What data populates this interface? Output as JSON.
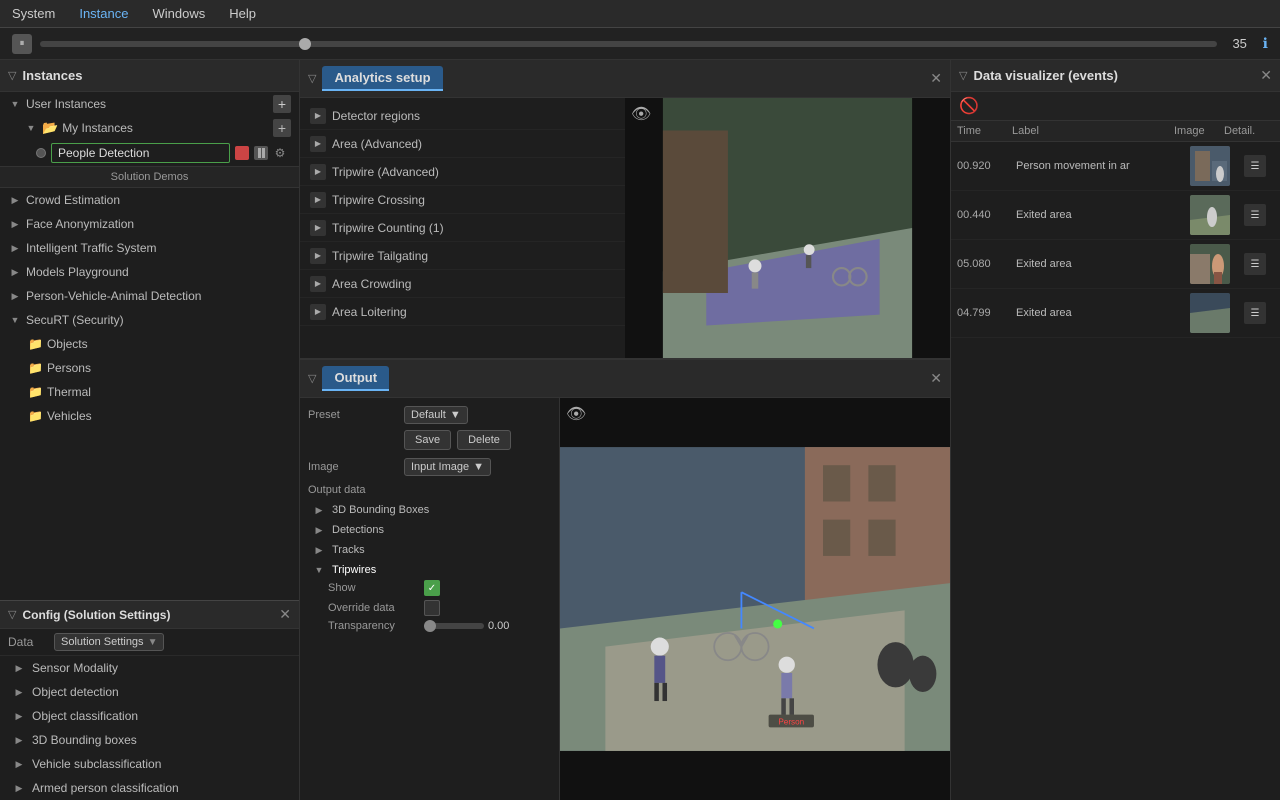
{
  "menubar": {
    "items": [
      {
        "label": "System",
        "active": false
      },
      {
        "label": "Instance",
        "active": true
      },
      {
        "label": "Windows",
        "active": false
      },
      {
        "label": "Help",
        "active": false
      }
    ]
  },
  "timeline": {
    "pause_label": "⏸",
    "value": "35",
    "info_label": "ℹ"
  },
  "instances_panel": {
    "title": "Instances",
    "user_instances_label": "User Instances",
    "my_instances_label": "My Instances",
    "active_instance_name": "People Detection",
    "solution_demos_label": "Solution Demos",
    "demos": [
      {
        "label": "Crowd Estimation"
      },
      {
        "label": "Face Anonymization"
      },
      {
        "label": "Intelligent Traffic System"
      },
      {
        "label": "Models Playground"
      },
      {
        "label": "Person-Vehicle-Animal Detection"
      }
    ],
    "security_label": "SecuRT (Security)",
    "security_items": [
      {
        "label": "Objects"
      },
      {
        "label": "Persons"
      },
      {
        "label": "Thermal"
      },
      {
        "label": "Vehicles"
      }
    ]
  },
  "config_panel": {
    "title": "Config (Solution Settings)",
    "data_label": "Data",
    "data_dropdown": "Solution Settings",
    "items": [
      {
        "label": "Sensor Modality"
      },
      {
        "label": "Object detection"
      },
      {
        "label": "Object classification"
      },
      {
        "label": "3D Bounding boxes"
      },
      {
        "label": "Vehicle subclassification"
      },
      {
        "label": "Armed person classification"
      }
    ]
  },
  "analytics_panel": {
    "title": "Analytics setup",
    "items": [
      {
        "label": "Detector regions"
      },
      {
        "label": "Area (Advanced)"
      },
      {
        "label": "Tripwire (Advanced)"
      },
      {
        "label": "Tripwire Crossing"
      },
      {
        "label": "Tripwire Counting (1)"
      },
      {
        "label": "Tripwire Tailgating"
      },
      {
        "label": "Area Crowding"
      },
      {
        "label": "Area Loitering"
      }
    ]
  },
  "output_panel": {
    "title": "Output",
    "preset_label": "Preset",
    "preset_value": "Default",
    "save_label": "Save",
    "delete_label": "Delete",
    "image_label": "Image",
    "image_value": "Input Image",
    "output_data_label": "Output data",
    "data_items": [
      {
        "label": "3D Bounding Boxes",
        "expanded": false
      },
      {
        "label": "Detections",
        "expanded": false
      },
      {
        "label": "Tracks",
        "expanded": false
      },
      {
        "label": "Tripwires",
        "expanded": true
      }
    ],
    "show_label": "Show",
    "override_label": "Override data",
    "transparency_label": "Transparency",
    "transparency_value": "0.00"
  },
  "data_visualizer": {
    "title": "Data visualizer (events)",
    "columns": {
      "time": "Time",
      "label": "Label",
      "image": "Image",
      "detail": "Detail."
    },
    "events": [
      {
        "time": "00.920",
        "label": "Person movement in ar",
        "has_image": true
      },
      {
        "time": "00.440",
        "label": "Exited area",
        "has_image": true
      },
      {
        "time": "05.080",
        "label": "Exited area",
        "has_image": true
      },
      {
        "time": "04.799",
        "label": "Exited area",
        "has_image": true
      }
    ]
  },
  "icons": {
    "funnel": "▽",
    "play": "▶",
    "pause": "⏸",
    "close": "✕",
    "plus": "+",
    "gear": "⚙",
    "eye": "👁",
    "eye_slash": "🚫",
    "info": "ℹ",
    "check": "✓",
    "folder": "▶",
    "dropdown_arrow": "▼"
  }
}
